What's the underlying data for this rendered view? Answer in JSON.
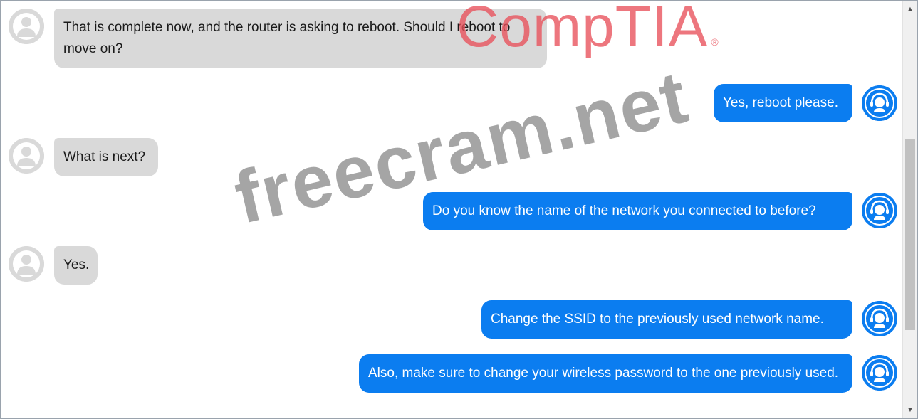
{
  "messages": [
    {
      "from": "user",
      "text": "That is complete now, and the router is asking to reboot. Should I reboot to move on?"
    },
    {
      "from": "agent",
      "text": "Yes, reboot please."
    },
    {
      "from": "user",
      "text": "What is next?"
    },
    {
      "from": "agent",
      "text": "Do you know the name of the network you connected to before?"
    },
    {
      "from": "user",
      "text": "Yes."
    },
    {
      "from": "agent",
      "text": "Change the SSID to the previously used network name."
    },
    {
      "from": "agent",
      "text": "Also, make sure to change your wireless password to the one previously used."
    }
  ],
  "watermarks": {
    "brand": "CompTIA",
    "brand_mark": "®",
    "site": "freecram.net"
  },
  "colors": {
    "agent_bubble": "#0b7df0",
    "user_bubble": "#d9d9d9",
    "brand_watermark": "#e8505a",
    "site_watermark": "#6e6e6e"
  },
  "icons": {
    "user_avatar": "user-silhouette-icon",
    "agent_avatar": "support-agent-headset-icon",
    "scroll_up": "arrow-up-icon",
    "scroll_down": "arrow-down-icon"
  }
}
